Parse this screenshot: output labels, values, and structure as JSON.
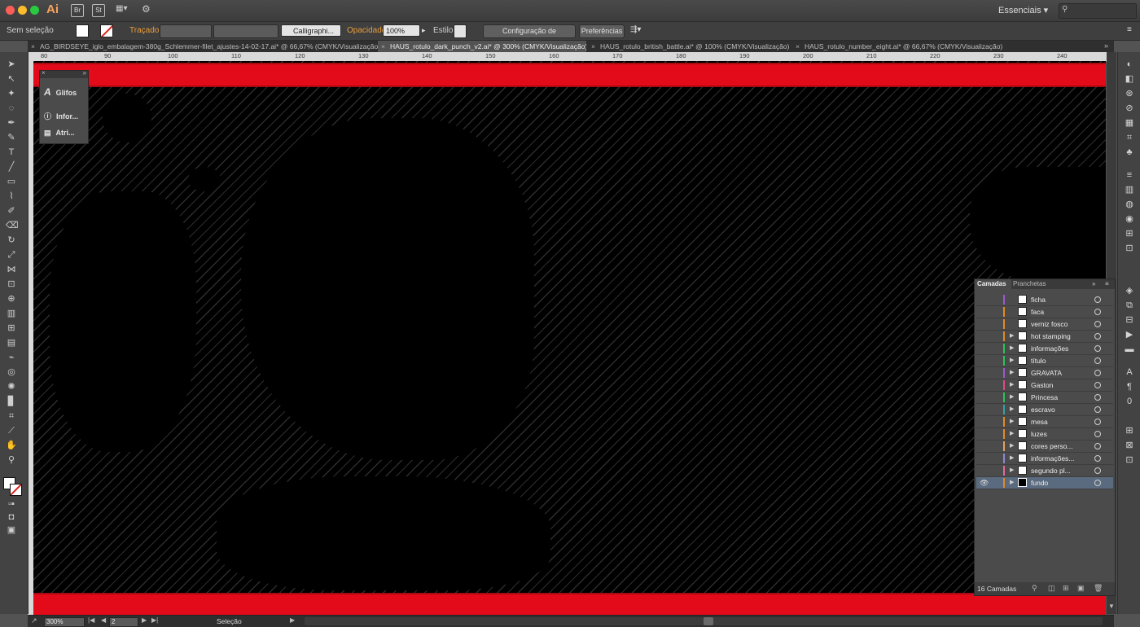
{
  "app": {
    "logo": "Ai",
    "bridge_icon": "Br",
    "stock_icon": "St",
    "workspace": "Essenciais",
    "workspace_caret": "▾"
  },
  "control_bar": {
    "selection_label": "Sem seleção",
    "stroke_label": "Traçado:",
    "brush_value": "Calligraphi...",
    "opacity_label": "Opacidade:",
    "opacity_value": "100%",
    "style_label": "Estilo:",
    "doc_setup_button": "Configuração de documento",
    "preferences_button": "Preferências"
  },
  "tabs": [
    {
      "label": "AG_BIRDSEYE_iglo_embalagem-380g_Schlemmer-filet_ajustes-14-02-17.ai* @ 66,67% (CMYK/Visualização)",
      "active": false
    },
    {
      "label": "HAUS_rotulo_dark_punch_v2.ai* @ 300% (CMYK/Visualização)",
      "active": true
    },
    {
      "label": "HAUS_rotulo_british_battle.ai* @ 100% (CMYK/Visualização)",
      "active": false
    },
    {
      "label": "HAUS_rotulo_number_eight.ai* @ 66,67% (CMYK/Visualização)",
      "active": false
    }
  ],
  "ruler_numbers": [
    "80",
    "90",
    "100",
    "110",
    "120",
    "130",
    "140",
    "150",
    "160",
    "170",
    "180",
    "190",
    "200",
    "210",
    "220",
    "230",
    "240"
  ],
  "floating_panel": {
    "items": [
      {
        "label": "Glifos",
        "icon": "glyph-icon"
      },
      {
        "label": "Infor...",
        "icon": "info-icon"
      },
      {
        "label": "Atri...",
        "icon": "attributes-icon"
      }
    ]
  },
  "layers_panel": {
    "tab_layers": "Camadas",
    "tab_artboards": "Pranchetas",
    "layers": [
      {
        "name": "ficha",
        "color": "#9b59d0",
        "expandable": false,
        "visible": false,
        "selected": false
      },
      {
        "name": "faca",
        "color": "#e08a2a",
        "expandable": false,
        "visible": false,
        "selected": false
      },
      {
        "name": "verniz fosco",
        "color": "#e08a2a",
        "expandable": false,
        "visible": false,
        "selected": false
      },
      {
        "name": "hot stamping",
        "color": "#e08a2a",
        "expandable": true,
        "visible": false,
        "selected": false
      },
      {
        "name": "informações",
        "color": "#2fbf5a",
        "expandable": true,
        "visible": false,
        "selected": false
      },
      {
        "name": "título",
        "color": "#2fbf5a",
        "expandable": true,
        "visible": false,
        "selected": false
      },
      {
        "name": "GRAVATA",
        "color": "#9b59d0",
        "expandable": true,
        "visible": false,
        "selected": false
      },
      {
        "name": "Gaston",
        "color": "#e04a8a",
        "expandable": true,
        "visible": false,
        "selected": false
      },
      {
        "name": "Princesa",
        "color": "#2fbf5a",
        "expandable": true,
        "visible": false,
        "selected": false
      },
      {
        "name": "escravo",
        "color": "#3aa0a0",
        "expandable": true,
        "visible": false,
        "selected": false
      },
      {
        "name": "mesa",
        "color": "#e08a2a",
        "expandable": true,
        "visible": false,
        "selected": false
      },
      {
        "name": "luzes",
        "color": "#e08a2a",
        "expandable": true,
        "visible": false,
        "selected": false
      },
      {
        "name": "cores perso...",
        "color": "#e0a060",
        "expandable": true,
        "visible": false,
        "selected": false
      },
      {
        "name": "informações...",
        "color": "#8a8ad0",
        "expandable": true,
        "visible": false,
        "selected": false
      },
      {
        "name": "segundo pl...",
        "color": "#e06aa0",
        "expandable": true,
        "visible": false,
        "selected": false
      },
      {
        "name": "fundo",
        "color": "#e08a2a",
        "expandable": true,
        "visible": true,
        "selected": true
      }
    ],
    "count_label": "16 Camadas"
  },
  "status_bar": {
    "zoom": "300%",
    "artboard": "2",
    "tool_name": "Seleção"
  },
  "colors": {
    "red_band": "#e30a1a",
    "canvas_black": "#000000",
    "accent_orange": "#e99d3a"
  }
}
